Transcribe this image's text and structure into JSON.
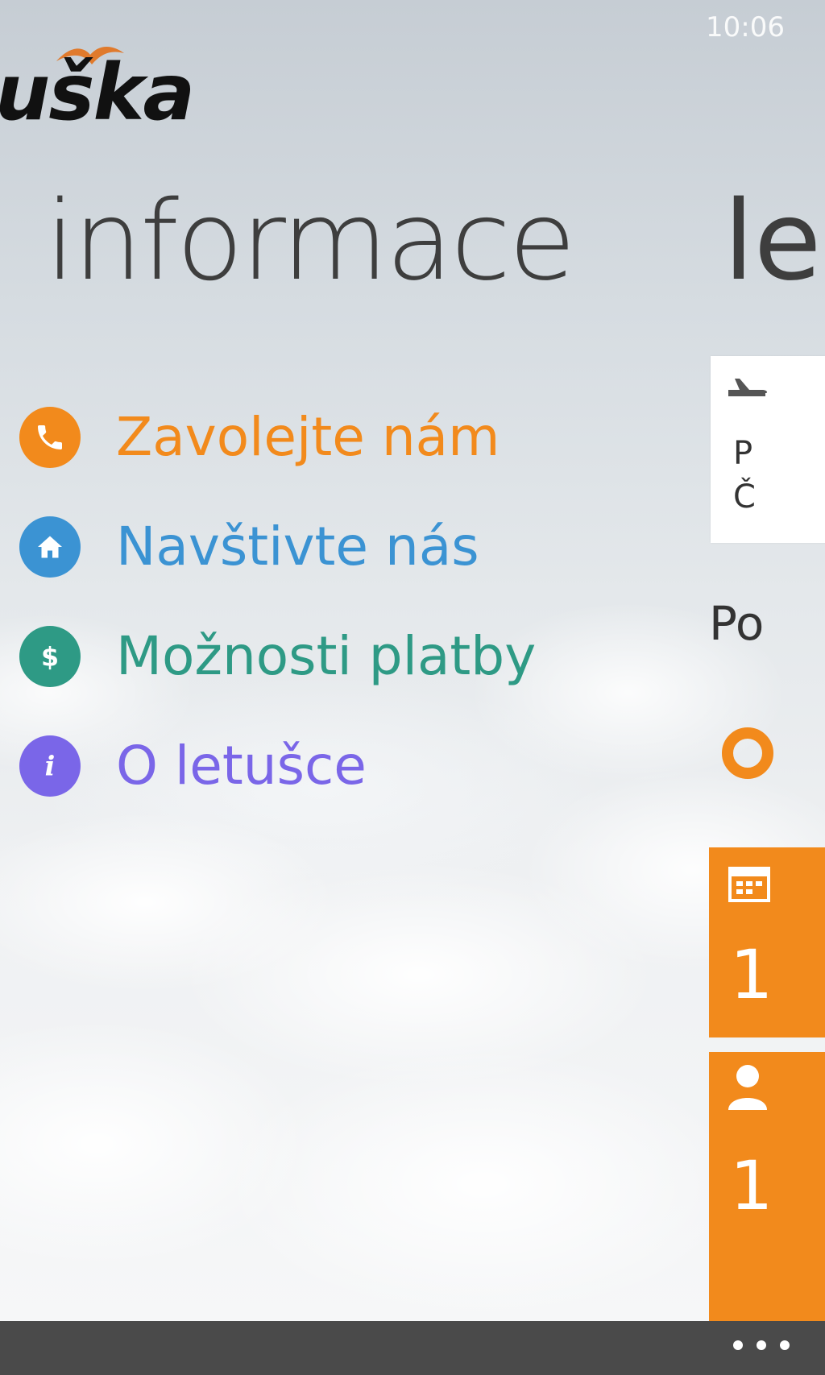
{
  "status_bar": {
    "time": "10:06"
  },
  "logo": {
    "text": "uška",
    "bird_color": "#e07a2c"
  },
  "section": {
    "title": "informace",
    "next_title_fragment": "le"
  },
  "menu": [
    {
      "label": "Zavolejte nám",
      "icon": "phone-icon",
      "color": "#f28a1c"
    },
    {
      "label": "Navštivte nás",
      "icon": "home-icon",
      "color": "#3b93d3"
    },
    {
      "label": "Možnosti platby",
      "icon": "dollar-icon",
      "color": "#2e9a85"
    },
    {
      "label": "O letušce",
      "icon": "info-icon",
      "color": "#7a66e8"
    }
  ],
  "peek": {
    "card_lines": [
      "P",
      "Č"
    ],
    "subheading": "Po",
    "tiles": [
      {
        "icon": "calendar-icon",
        "value": "1"
      },
      {
        "icon": "person-icon",
        "value": "1"
      }
    ],
    "accent": "#f28a1c"
  },
  "app_bar": {
    "more": "more-icon"
  }
}
